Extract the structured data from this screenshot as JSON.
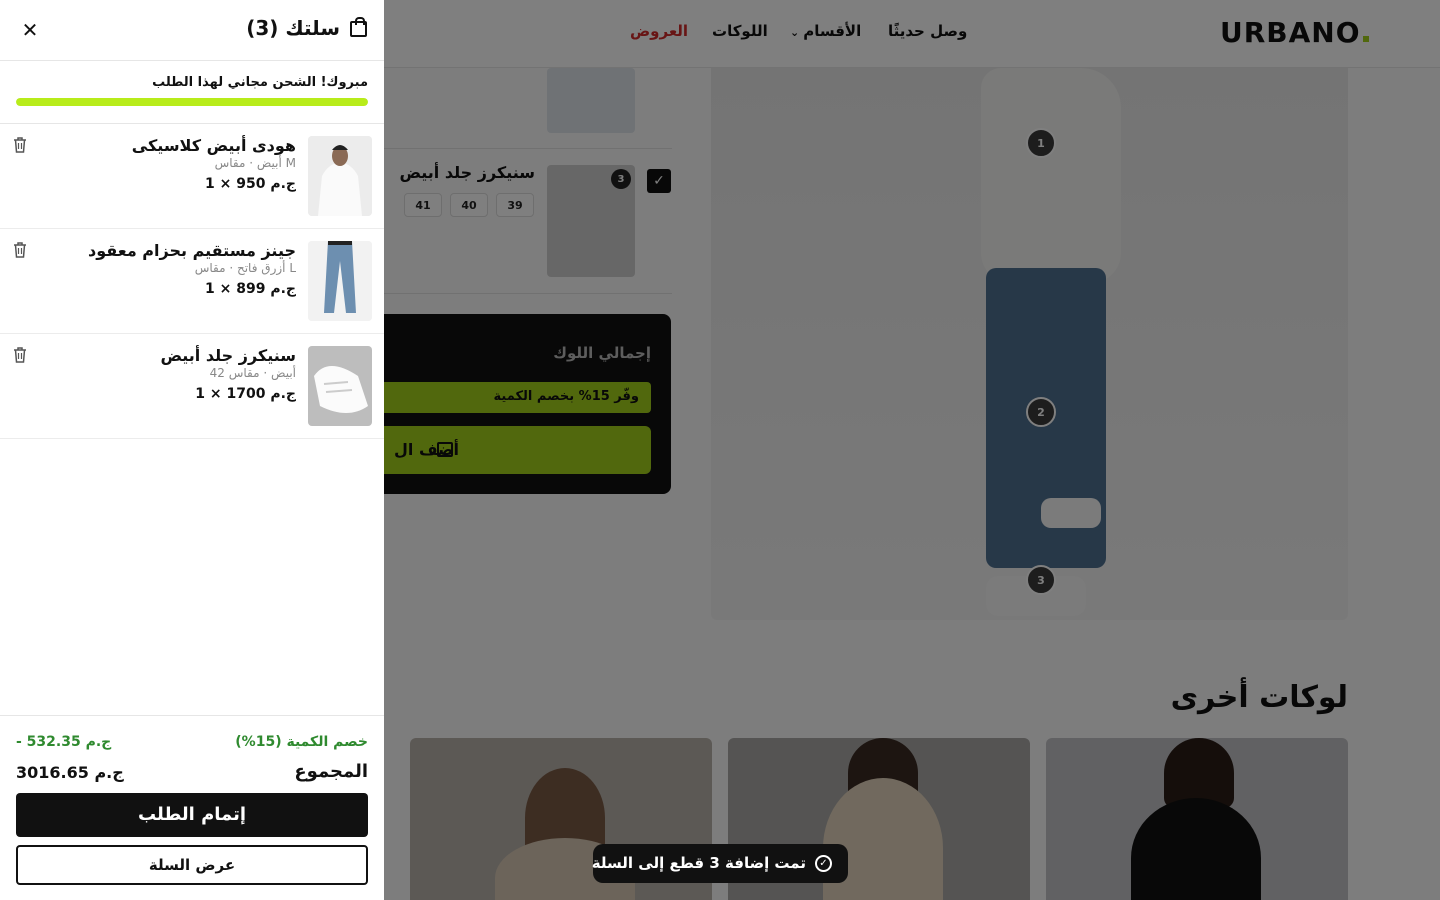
{
  "header": {
    "logo": "URBANO",
    "nav": {
      "new": "وصل حديثًا",
      "categories": "الأقسام",
      "looks": "اللوكات",
      "offers": "العروض"
    }
  },
  "look": {
    "hotspots": [
      "1",
      "2",
      "3"
    ],
    "products": [
      {
        "name": "سنيكرز جلد أبيض",
        "badge": "3",
        "sizes": [
          "39",
          "40",
          "41"
        ],
        "checked": true
      }
    ],
    "summary": {
      "title": "إجمالي اللوك",
      "save_text": "وفّر 15% بخصم الكمية",
      "add_label": "أضف ال"
    }
  },
  "more_looks": {
    "title": "لوكات أخرى"
  },
  "toast": {
    "text": "تمت إضافة 3 قطع إلى السلة",
    "icon": "check-circle-icon"
  },
  "cart": {
    "title": "سلتك (3)",
    "shipping_message": "مبروك! الشحن مجاني لهذا الطلب",
    "shipping_progress": 1.0,
    "items": [
      {
        "name": "هودى أبيض كلاسيكى",
        "variant": "أبيض · مقاس M",
        "price": "1 × 950 ج.م"
      },
      {
        "name": "جينز مستقيم بحزام معقود",
        "variant": "أزرق فاتح · مقاس L",
        "price": "1 × 899 ج.م"
      },
      {
        "name": "سنيكرز جلد أبيض",
        "variant": "أبيض · مقاس 42",
        "price": "1 × 1700 ج.م"
      }
    ],
    "discount_label": "خصم الكمية (15%)",
    "discount_value": "- 532.35 ج.م",
    "total_label": "المجموع",
    "total_value": "3016.65 ج.م",
    "checkout_label": "إتمام الطلب",
    "view_cart_label": "عرض السلة"
  },
  "colors": {
    "accent": "#a3d11a",
    "offer": "#d02a2a",
    "discount": "#2f8a2f",
    "dark": "#111111"
  }
}
